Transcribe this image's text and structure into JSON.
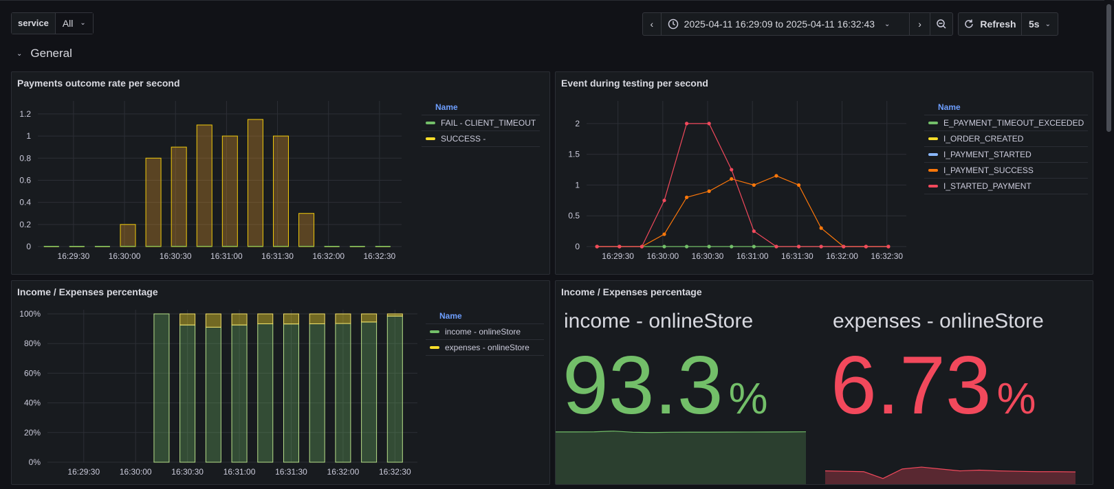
{
  "variable": {
    "label": "service",
    "value": "All"
  },
  "timepicker": {
    "range": "2025-04-11 16:29:09 to 2025-04-11 16:32:43",
    "refresh_label": "Refresh",
    "interval": "5s"
  },
  "row": {
    "title": "General"
  },
  "panels": {
    "payments": {
      "title": "Payments outcome rate per second",
      "legend_header": "Name",
      "legend": [
        {
          "name": "FAIL - CLIENT_TIMEOUT",
          "color": "#73bf69"
        },
        {
          "name": "SUCCESS -",
          "color": "#fade2a"
        }
      ]
    },
    "events": {
      "title": "Event during testing per second",
      "legend_header": "Name",
      "legend": [
        {
          "name": "E_PAYMENT_TIMEOUT_EXCEEDED",
          "color": "#73bf69"
        },
        {
          "name": "I_ORDER_CREATED",
          "color": "#fade2a"
        },
        {
          "name": "I_PAYMENT_STARTED",
          "color": "#8ab8ff"
        },
        {
          "name": "I_PAYMENT_SUCCESS",
          "color": "#ff780a"
        },
        {
          "name": "I_STARTED_PAYMENT",
          "color": "#f2495c"
        }
      ]
    },
    "income_bars": {
      "title": "Income / Expenses percentage",
      "legend_header": "Name",
      "legend": [
        {
          "name": "income - onlineStore",
          "color": "#73bf69"
        },
        {
          "name": "expenses - onlineStore",
          "color": "#fade2a"
        }
      ]
    },
    "income_stat": {
      "title": "Income / Expenses percentage",
      "stats": [
        {
          "name": "income - onlineStore",
          "value": "93.3",
          "unit": "%",
          "color": "#73bf69"
        },
        {
          "name": "expenses - onlineStore",
          "value": "6.73",
          "unit": "%",
          "color": "#f2495c"
        }
      ]
    }
  },
  "chart_data": [
    {
      "type": "bar",
      "title": "Payments outcome rate per second",
      "x_ticks": [
        "16:29:30",
        "16:30:00",
        "16:30:30",
        "16:31:00",
        "16:31:30",
        "16:32:00",
        "16:32:30"
      ],
      "y_ticks": [
        "0",
        "0.2",
        "0.4",
        "0.6",
        "0.8",
        "1",
        "1.2"
      ],
      "ylim": [
        0,
        1.28
      ],
      "x_seconds_range": [
        0,
        214
      ],
      "bar_seconds": [
        0,
        15,
        30,
        45,
        60,
        75,
        90,
        105,
        120,
        135,
        150,
        165,
        180,
        195
      ],
      "series": [
        {
          "name": "FAIL - CLIENT_TIMEOUT",
          "values": [
            0,
            0,
            0,
            0,
            0,
            0,
            0,
            0,
            0,
            0,
            0,
            0,
            0,
            0
          ]
        },
        {
          "name": "SUCCESS -",
          "values": [
            0,
            0,
            0,
            0.2,
            0.8,
            0.9,
            1.1,
            1.0,
            1.15,
            1.0,
            0.3,
            0,
            0,
            0
          ]
        }
      ]
    },
    {
      "type": "line",
      "title": "Event during testing per second",
      "x_ticks": [
        "16:29:30",
        "16:30:00",
        "16:30:30",
        "16:31:00",
        "16:31:30",
        "16:32:00",
        "16:32:30"
      ],
      "y_ticks": [
        "0",
        "0.5",
        "1",
        "1.5",
        "2"
      ],
      "ylim": [
        0,
        2.3
      ],
      "x_seconds_range": [
        0,
        214
      ],
      "x_seconds": [
        0,
        15,
        30,
        45,
        60,
        75,
        90,
        105,
        120,
        135,
        150,
        165,
        180,
        195
      ],
      "series": [
        {
          "name": "E_PAYMENT_TIMEOUT_EXCEEDED",
          "values": [
            0,
            0,
            0,
            0,
            0,
            0,
            0,
            0,
            0,
            0,
            0,
            0,
            0,
            0
          ]
        },
        {
          "name": "I_PAYMENT_SUCCESS",
          "values": [
            0,
            0,
            0,
            0.2,
            0.8,
            0.9,
            1.1,
            1.0,
            1.15,
            1.0,
            0.3,
            0,
            0,
            0
          ]
        },
        {
          "name": "I_STARTED_PAYMENT",
          "values": [
            0,
            0,
            0,
            0.75,
            2,
            2,
            1.25,
            0.25,
            0,
            0,
            0,
            0,
            0,
            0
          ]
        }
      ]
    },
    {
      "type": "bar",
      "title": "Income / Expenses percentage",
      "stacked": true,
      "x_ticks": [
        "16:29:30",
        "16:30:00",
        "16:30:30",
        "16:31:00",
        "16:31:30",
        "16:32:00",
        "16:32:30"
      ],
      "y_ticks": [
        "0%",
        "20%",
        "40%",
        "60%",
        "80%",
        "100%"
      ],
      "ylim": [
        0,
        100
      ],
      "x_seconds_range": [
        0,
        214
      ],
      "bar_seconds": [
        60,
        75,
        90,
        105,
        120,
        135,
        150,
        165,
        180,
        195
      ],
      "series": [
        {
          "name": "income - onlineStore",
          "values": [
            100,
            92.5,
            91,
            92.5,
            93.3,
            93.2,
            93.3,
            93.5,
            94.5,
            98.5
          ]
        },
        {
          "name": "expenses - onlineStore",
          "values": [
            0,
            7.5,
            9,
            7.5,
            6.7,
            6.8,
            6.7,
            6.5,
            5.5,
            1.5
          ]
        }
      ]
    },
    {
      "type": "area",
      "title": "Income / Expenses percentage",
      "series": [
        {
          "name": "income - onlineStore",
          "values": [
            93,
            93,
            93.2,
            94.5,
            92.5,
            92,
            92.5,
            92.6,
            92.6,
            92.7,
            92.8,
            92.9,
            93,
            93.3
          ]
        },
        {
          "name": "expenses - onlineStore",
          "values": [
            7,
            6.9,
            6.8,
            5,
            7.5,
            8,
            7.5,
            7,
            7.2,
            7,
            6.9,
            6.8,
            6.8,
            6.73
          ]
        }
      ]
    }
  ]
}
